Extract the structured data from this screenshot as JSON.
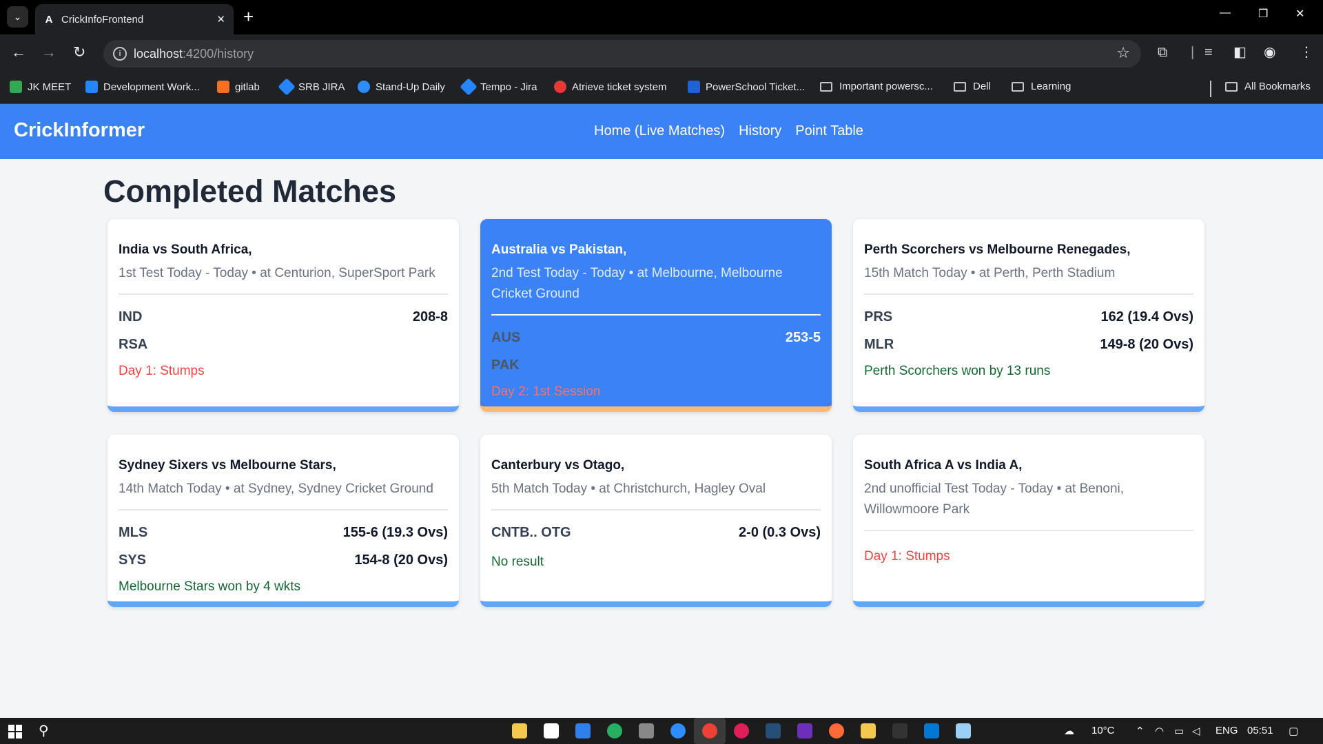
{
  "browser": {
    "tab_title": "CrickInfoFrontend",
    "url_host": "localhost",
    "url_path": ":4200/history",
    "bookmarks": [
      {
        "label": "JK MEET",
        "color": "#34a853"
      },
      {
        "label": "Development Work...",
        "color": "#2684ff"
      },
      {
        "label": "gitlab",
        "color": "#fc6d26"
      },
      {
        "label": "SRB JIRA",
        "color": "#2684ff"
      },
      {
        "label": "Stand-Up Daily",
        "color": "#2d8cff"
      },
      {
        "label": "Tempo - Jira",
        "color": "#2684ff"
      },
      {
        "label": "Atrieve ticket system",
        "color": "#e53935"
      },
      {
        "label": "PowerSchool Ticket...",
        "color": "#1e63d6"
      }
    ],
    "bookmark_folders": [
      "Important powersc...",
      "Dell",
      "Learning"
    ],
    "all_bookmarks": "All Bookmarks"
  },
  "app": {
    "brand": "CrickInformer",
    "nav": [
      "Home (Live Matches)",
      "History",
      "Point Table"
    ],
    "page_title": "Completed Matches",
    "matches": [
      {
        "title": "India vs South Africa,",
        "subtitle": "1st Test Today - Today • at Centurion, SuperSport Park",
        "teams": [
          {
            "team": "IND",
            "score": "208-8"
          },
          {
            "team": "RSA",
            "score": ""
          }
        ],
        "status": "Day 1: Stumps",
        "status_type": "red"
      },
      {
        "title": "Australia vs Pakistan,",
        "subtitle": "2nd Test Today - Today • at Melbourne, Melbourne Cricket Ground",
        "teams": [
          {
            "team": "AUS",
            "score": "253-5"
          },
          {
            "team": "PAK",
            "score": ""
          }
        ],
        "status": "Day 2: 1st Session",
        "status_type": "pink",
        "highlight": true
      },
      {
        "title": "Perth Scorchers vs Melbourne Renegades,",
        "subtitle": "15th Match Today • at Perth, Perth Stadium",
        "teams": [
          {
            "team": "PRS",
            "score": "162 (19.4 Ovs)"
          },
          {
            "team": "MLR",
            "score": "149-8 (20 Ovs)"
          }
        ],
        "status": "Perth Scorchers won by 13 runs",
        "status_type": "green"
      },
      {
        "title": "Sydney Sixers vs Melbourne Stars,",
        "subtitle": "14th Match Today • at Sydney, Sydney Cricket Ground",
        "teams": [
          {
            "team": "MLS",
            "score": "155-6 (19.3 Ovs)"
          },
          {
            "team": "SYS",
            "score": "154-8 (20 Ovs)"
          }
        ],
        "status": "Melbourne Stars won by 4 wkts",
        "status_type": "green"
      },
      {
        "title": "Canterbury vs Otago,",
        "subtitle": "5th Match Today • at Christchurch, Hagley Oval",
        "teams": [
          {
            "team": "CNTB.. OTG",
            "score": "2-0 (0.3 Ovs)"
          }
        ],
        "status": "No result",
        "status_type": "green"
      },
      {
        "title": "South Africa A vs India A,",
        "subtitle": "2nd unofficial Test Today - Today • at Benoni, Willowmoore Park",
        "teams": [],
        "status": "Day 1: Stumps",
        "status_type": "red"
      }
    ]
  },
  "taskbar": {
    "weather": "10°C",
    "language": "ENG",
    "time": "05:51"
  }
}
